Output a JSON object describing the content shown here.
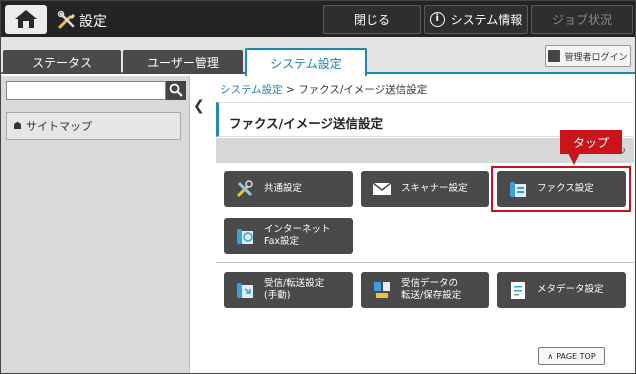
{
  "topbar": {
    "title": "設定",
    "close_label": "閉じる",
    "sysinfo_label": "システム情報",
    "job_label": "ジョブ状況"
  },
  "tabs": [
    {
      "label": "ステータス",
      "active": false
    },
    {
      "label": "ユーザー管理",
      "active": false
    },
    {
      "label": "システム設定",
      "active": true
    }
  ],
  "admin_login_label": "管理者ログイン",
  "sidebar": {
    "search_placeholder": "",
    "sitemap_label": "サイトマップ"
  },
  "breadcrumb": {
    "root": "システム設定",
    "separator": ">",
    "current": "ファクス/イメージ送信設定"
  },
  "page_title": "ファクス/イメージ送信設定",
  "tiles": {
    "common": {
      "line1": "共通設定",
      "line2": ""
    },
    "scanner": {
      "line1": "スキャナー設定",
      "line2": ""
    },
    "fax": {
      "line1": "ファクス設定",
      "line2": ""
    },
    "inet": {
      "line1": "インターネット",
      "line2": "Fax設定"
    },
    "recv": {
      "line1": "受信/転送設定",
      "line2": "(手動)"
    },
    "recvdata": {
      "line1": "受信データの",
      "line2": "転送/保存設定"
    },
    "meta": {
      "line1": "メタデータ設定",
      "line2": ""
    }
  },
  "callout_label": "タップ",
  "page_top_label": "PAGE TOP",
  "colors": {
    "accent": "#1e89b4",
    "callout": "#c9141b",
    "tile": "#4a4a4a",
    "topbar": "#242424"
  }
}
